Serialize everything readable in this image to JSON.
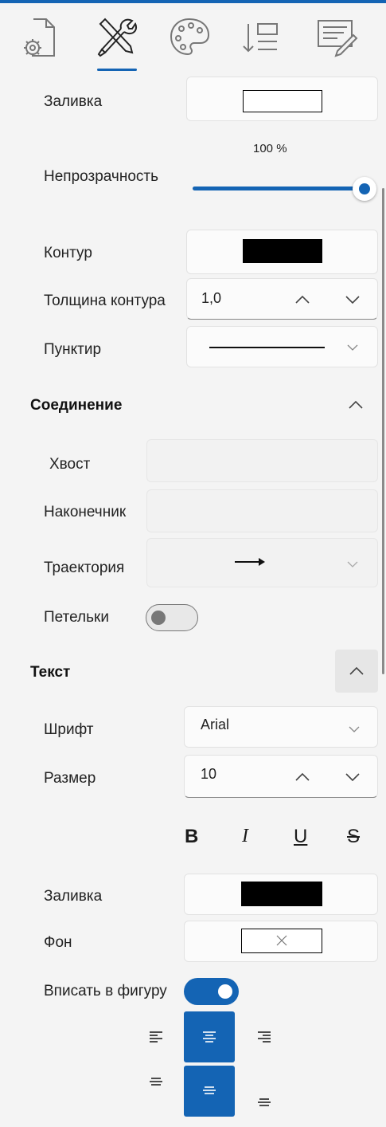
{
  "tabs": [
    {
      "icon": "document-settings-icon"
    },
    {
      "icon": "tools-icon"
    },
    {
      "icon": "palette-icon"
    },
    {
      "icon": "arrange-icon"
    },
    {
      "icon": "edit-text-icon"
    }
  ],
  "shape": {
    "fill_label": "Заливка",
    "fill_color": "#ffffff",
    "opacity_label": "Непрозрачность",
    "opacity_value_text": "100 %",
    "opacity_fraction": 1.0,
    "outline_label": "Контур",
    "outline_color": "#000000",
    "outline_width_label": "Толщина контура",
    "outline_width_value": "1,0",
    "dash_label": "Пунктир"
  },
  "connection": {
    "title": "Соединение",
    "tail_label": "Хвост",
    "head_label": "Наконечник",
    "trajectory_label": "Траектория",
    "loops_label": "Петельки",
    "loops_on": false
  },
  "text": {
    "title": "Текст",
    "font_label": "Шрифт",
    "font_value": "Arial",
    "size_label": "Размер",
    "size_value": "10",
    "bold": "B",
    "italic": "I",
    "underline": "U",
    "strike": "S",
    "fill_label": "Заливка",
    "fill_color": "#000000",
    "background_label": "Фон",
    "fit_label": "Вписать в фигуру",
    "fit_on": true
  },
  "colors": {
    "accent": "#1464b4"
  }
}
